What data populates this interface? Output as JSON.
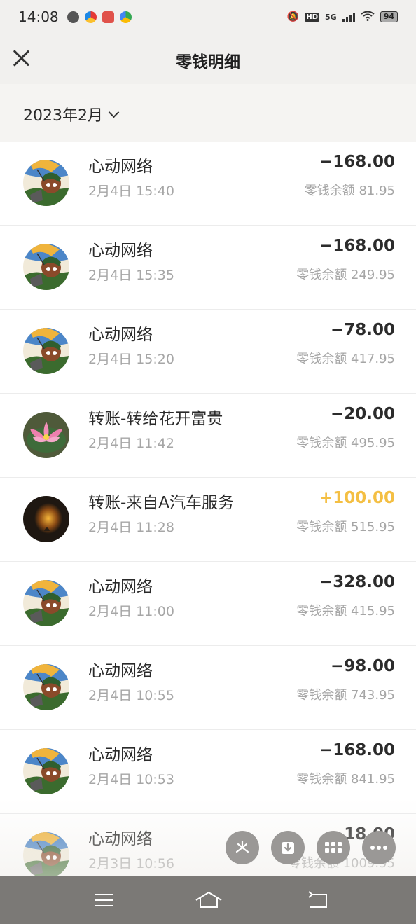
{
  "status_bar": {
    "time": "14:08",
    "network": "5G",
    "hd": "HD",
    "battery": "94"
  },
  "header": {
    "title": "零钱明细"
  },
  "filter": {
    "month": "2023年2月"
  },
  "colors": {
    "positive_amount": "#f4bf43",
    "negative_amount": "#2b2b2b",
    "secondary_text": "#a6a6a6"
  },
  "transactions": [
    {
      "name": "心动网络",
      "date": "2月4日 15:40",
      "amount": "−168.00",
      "balance": "零钱余额 81.95",
      "avatar": "game-avatar",
      "positive": false
    },
    {
      "name": "心动网络",
      "date": "2月4日 15:35",
      "amount": "−168.00",
      "balance": "零钱余额 249.95",
      "avatar": "game-avatar",
      "positive": false
    },
    {
      "name": "心动网络",
      "date": "2月4日 15:20",
      "amount": "−78.00",
      "balance": "零钱余额 417.95",
      "avatar": "game-avatar",
      "positive": false
    },
    {
      "name": "转账-转给花开富贵",
      "date": "2月4日 11:42",
      "amount": "−20.00",
      "balance": "零钱余额 495.95",
      "avatar": "lotus-avatar",
      "positive": false
    },
    {
      "name": "转账-来自A汽车服务",
      "date": "2月4日 11:28",
      "amount": "+100.00",
      "balance": "零钱余额 515.95",
      "avatar": "dark-avatar",
      "positive": true
    },
    {
      "name": "心动网络",
      "date": "2月4日 11:00",
      "amount": "−328.00",
      "balance": "零钱余额 415.95",
      "avatar": "game-avatar",
      "positive": false
    },
    {
      "name": "心动网络",
      "date": "2月4日 10:55",
      "amount": "−98.00",
      "balance": "零钱余额 743.95",
      "avatar": "game-avatar",
      "positive": false
    },
    {
      "name": "心动网络",
      "date": "2月4日 10:53",
      "amount": "−168.00",
      "balance": "零钱余额 841.95",
      "avatar": "game-avatar",
      "positive": false
    },
    {
      "name": "心动网络",
      "date": "2月3日 10:56",
      "amount": "−18.00",
      "balance": "零钱余额 1009.95",
      "avatar": "game-avatar",
      "positive": false
    }
  ],
  "floating_actions": [
    "pinwheel-icon",
    "download-icon",
    "grid-icon",
    "more-icon"
  ],
  "nav_bar": [
    "menu-icon",
    "home-icon",
    "back-icon"
  ]
}
